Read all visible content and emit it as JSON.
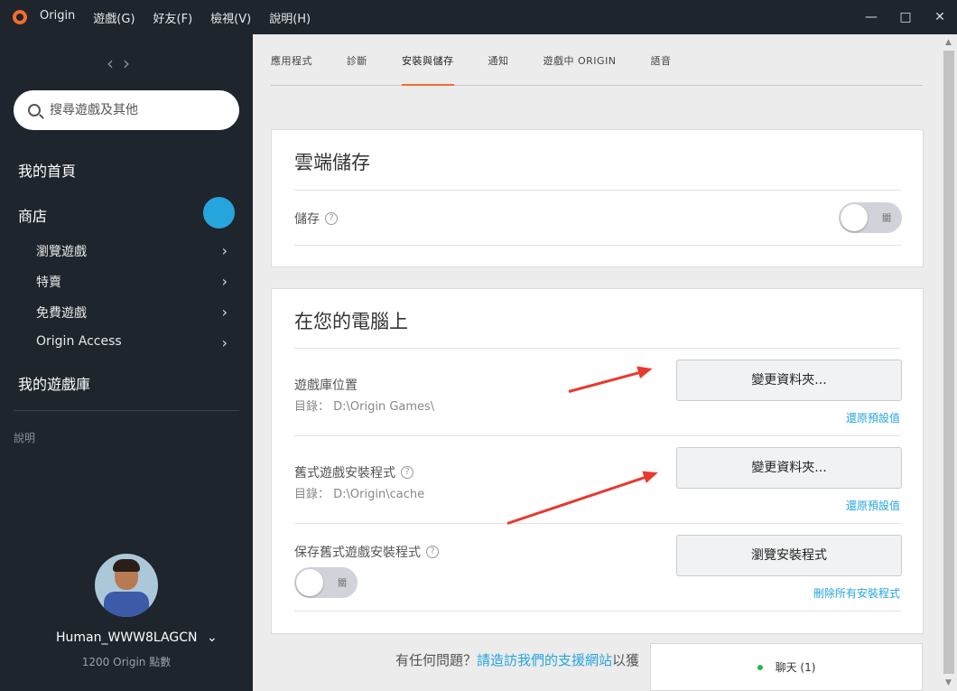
{
  "titlebar": {
    "app_name": "Origin",
    "menu": [
      "遊戲(G)",
      "好友(F)",
      "檢視(V)",
      "說明(H)"
    ],
    "min_glyph": "—",
    "max_glyph": "□",
    "close_glyph": "✕"
  },
  "sidebar": {
    "back_glyph": "‹",
    "forward_glyph": "›",
    "search_placeholder": "搜尋遊戲及其他",
    "home": "我的首頁",
    "store": "商店",
    "store_items": [
      "瀏覽遊戲",
      "特賣",
      "免費遊戲",
      "Origin Access"
    ],
    "library": "我的遊戲庫",
    "help": "說明",
    "username": "Human_WWW8LAGCN",
    "user_chevron": "⌄",
    "points": "1200 Origin 點數",
    "chev": "›"
  },
  "tabs": [
    "應用程式",
    "診斷",
    "安裝與儲存",
    "通知",
    "遊戲中 ORIGIN",
    "語音"
  ],
  "cloud": {
    "title": "雲端儲存",
    "storage_label": "儲存",
    "toggle_text": "關"
  },
  "computer": {
    "title": "在您的電腦上",
    "library_label": "遊戲庫位置",
    "library_path": "目錄： D:\\Origin Games\\",
    "change_folder": "變更資料夾...",
    "restore_default": "還原預設值",
    "legacy_label": "舊式遊戲安裝程式",
    "legacy_path": "目錄： D:\\Origin\\cache",
    "keep_label": "保存舊式遊戲安裝程式",
    "browse_installers": "瀏覽安裝程式",
    "delete_installers": "刪除所有安裝程式",
    "toggle_text": "關"
  },
  "footer": {
    "question": "有任何問題？",
    "link": "請造訪我們的支援網站",
    "tail": "以獲"
  },
  "chat": {
    "label": "聊天 (1)"
  },
  "help_mark": "?",
  "colors": {
    "accent": "#f56c2d",
    "link": "#26a5dd",
    "online": "#2ab34a",
    "arrow": "#e8392e"
  }
}
